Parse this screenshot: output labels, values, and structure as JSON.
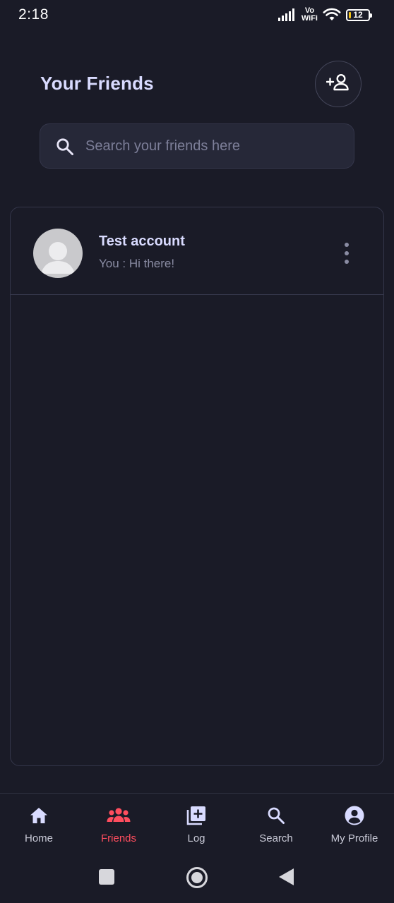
{
  "status_bar": {
    "time": "2:18",
    "network_label_top": "Vo",
    "network_label_bottom": "WiFi",
    "battery": "12"
  },
  "header": {
    "title": "Your Friends",
    "add_friend_icon": "person-add-icon"
  },
  "search": {
    "placeholder": "Search your friends here",
    "icon": "search-icon"
  },
  "friends": [
    {
      "name": "Test account",
      "last_message": "You : Hi there!",
      "avatar": "default-avatar-icon",
      "menu_icon": "more-vert-icon"
    }
  ],
  "bottom_nav": {
    "active": "Friends",
    "items": [
      {
        "label": "Home",
        "icon": "home-icon"
      },
      {
        "label": "Friends",
        "icon": "group-icon"
      },
      {
        "label": "Log",
        "icon": "library-add-icon"
      },
      {
        "label": "Search",
        "icon": "search-icon"
      },
      {
        "label": "My Profile",
        "icon": "account-circle-icon"
      }
    ]
  },
  "colors": {
    "background": "#1a1b27",
    "title": "#d9dbff",
    "accent_active": "#ff4d5e",
    "muted_text": "#8a8ca3",
    "border": "#34364a"
  }
}
